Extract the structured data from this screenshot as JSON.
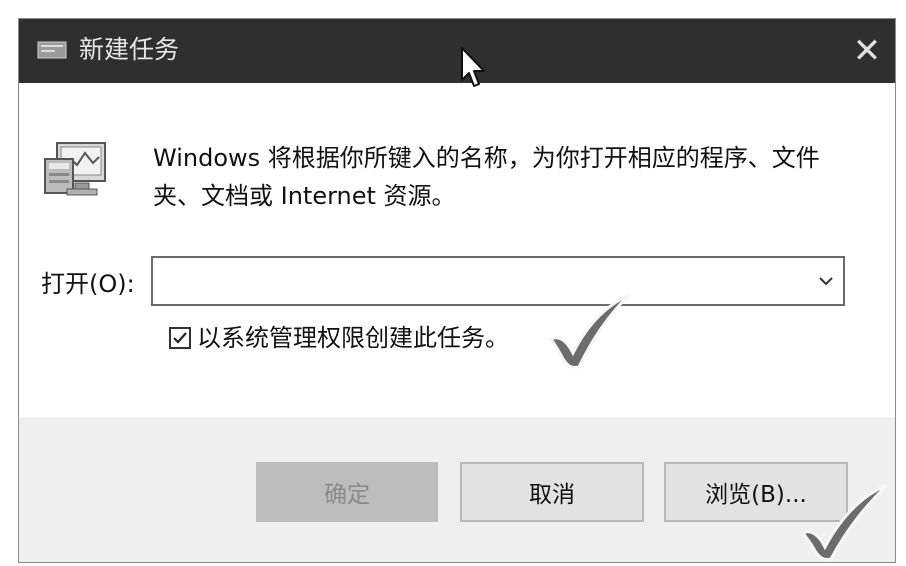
{
  "window": {
    "title": "新建任务",
    "title_icon": "run-app-icon",
    "close_glyph": "✕"
  },
  "content": {
    "icon": "run-program-icon",
    "description": "Windows 将根据你所键入的名称，为你打开相应的程序、文件夹、文档或 Internet 资源。",
    "open_label": "打开(O):",
    "open_value": "",
    "admin_checkbox": {
      "label": "以系统管理权限创建此任务。",
      "checked": true
    }
  },
  "buttons": {
    "ok_label": "确定",
    "ok_enabled": false,
    "cancel_label": "取消",
    "browse_label": "浏览(B)..."
  },
  "annotations": {
    "mark_icon": "checkmark-annotation-icon"
  },
  "colors": {
    "titlebar": "#2f2f2f",
    "footer": "#efefef",
    "button": "#e2e2e2",
    "disabled_button": "#bdbdbd"
  }
}
